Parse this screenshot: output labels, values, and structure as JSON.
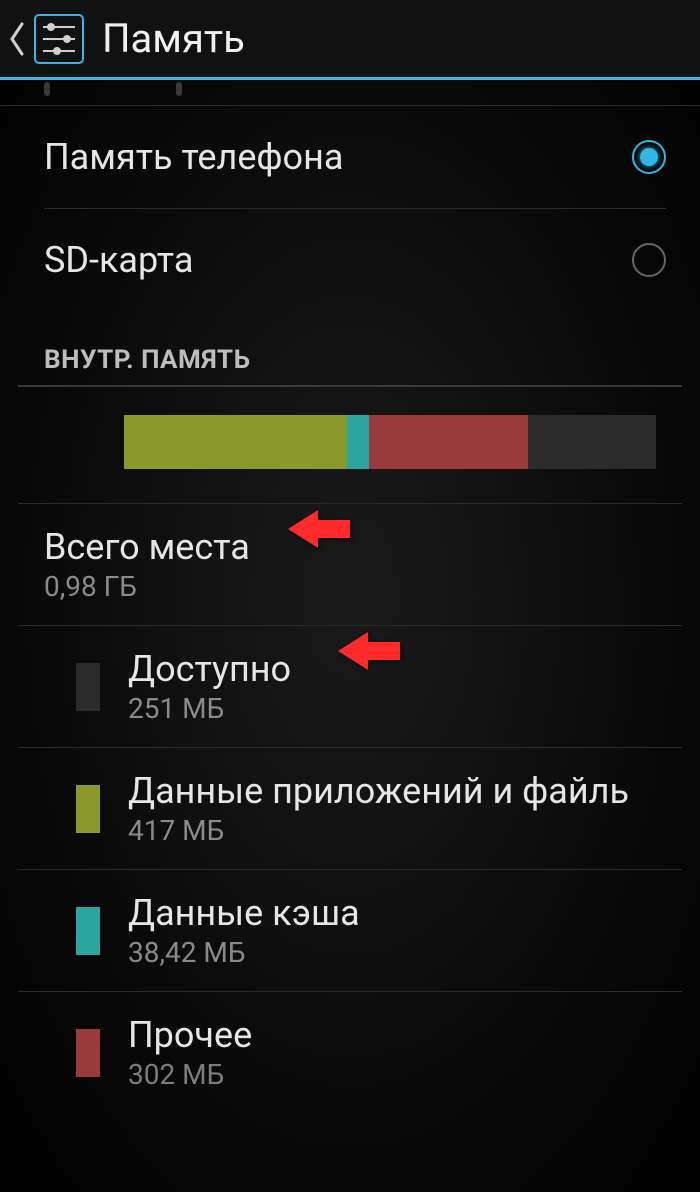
{
  "header": {
    "title": "Память"
  },
  "radios": {
    "phone": {
      "label": "Память телефона",
      "selected": true
    },
    "sd": {
      "label": "SD-карта",
      "selected": false
    }
  },
  "section": {
    "title": "ВНУТР. ПАМЯТЬ"
  },
  "storage_bar": {
    "apps_pct": 42,
    "cache_pct": 4,
    "other_pct": 30,
    "free_pct": 24
  },
  "items": {
    "total": {
      "title": "Всего места",
      "value": "0,98 ГБ"
    },
    "available": {
      "title": "Доступно",
      "value": "251 МБ"
    },
    "apps": {
      "title": "Данные приложений и файль",
      "value": "417 МБ"
    },
    "cache": {
      "title": "Данные кэша",
      "value": "38,42 МБ"
    },
    "other": {
      "title": "Прочее",
      "value": "302 МБ"
    }
  },
  "annotations": {
    "arrow_color": "#ff2a2a"
  }
}
